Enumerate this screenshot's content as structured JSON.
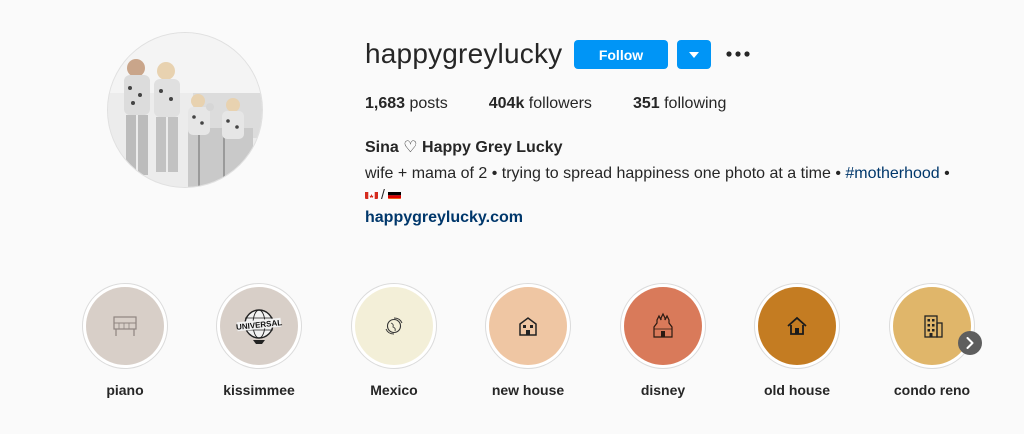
{
  "profile": {
    "username": "happygreylucky",
    "follow_label": "Follow",
    "stats": {
      "posts_count": "1,683",
      "posts_label": "posts",
      "followers_count": "404k",
      "followers_label": "followers",
      "following_count": "351",
      "following_label": "following"
    },
    "full_name": "Sina ♡ Happy Grey Lucky",
    "bio_text": "wife + mama of 2 • trying to spread happiness one photo at a time •",
    "bio_hashtag": "#motherhood",
    "bio_end": " •",
    "bio_flag_separator": "/",
    "website": "happygreylucky.com"
  },
  "highlights": [
    {
      "label": "piano",
      "bg": "#d8cfc8",
      "icon": "piano-icon"
    },
    {
      "label": "kissimmee",
      "bg": "#d8cfc8",
      "icon": "universal-globe-icon",
      "icon_text": "UNIVERSAL"
    },
    {
      "label": "Mexico",
      "bg": "#f3efd8",
      "icon": "globe-icon"
    },
    {
      "label": "new house",
      "bg": "#efc6a3",
      "icon": "building-icon"
    },
    {
      "label": "disney",
      "bg": "#d97a5a",
      "icon": "castle-icon"
    },
    {
      "label": "old house",
      "bg": "#c47c22",
      "icon": "house-icon"
    },
    {
      "label": "condo reno",
      "bg": "#e0b66a",
      "icon": "apartment-icon"
    }
  ],
  "colors": {
    "accent": "#0095f6",
    "link": "#00376b",
    "background": "#fafafa"
  }
}
